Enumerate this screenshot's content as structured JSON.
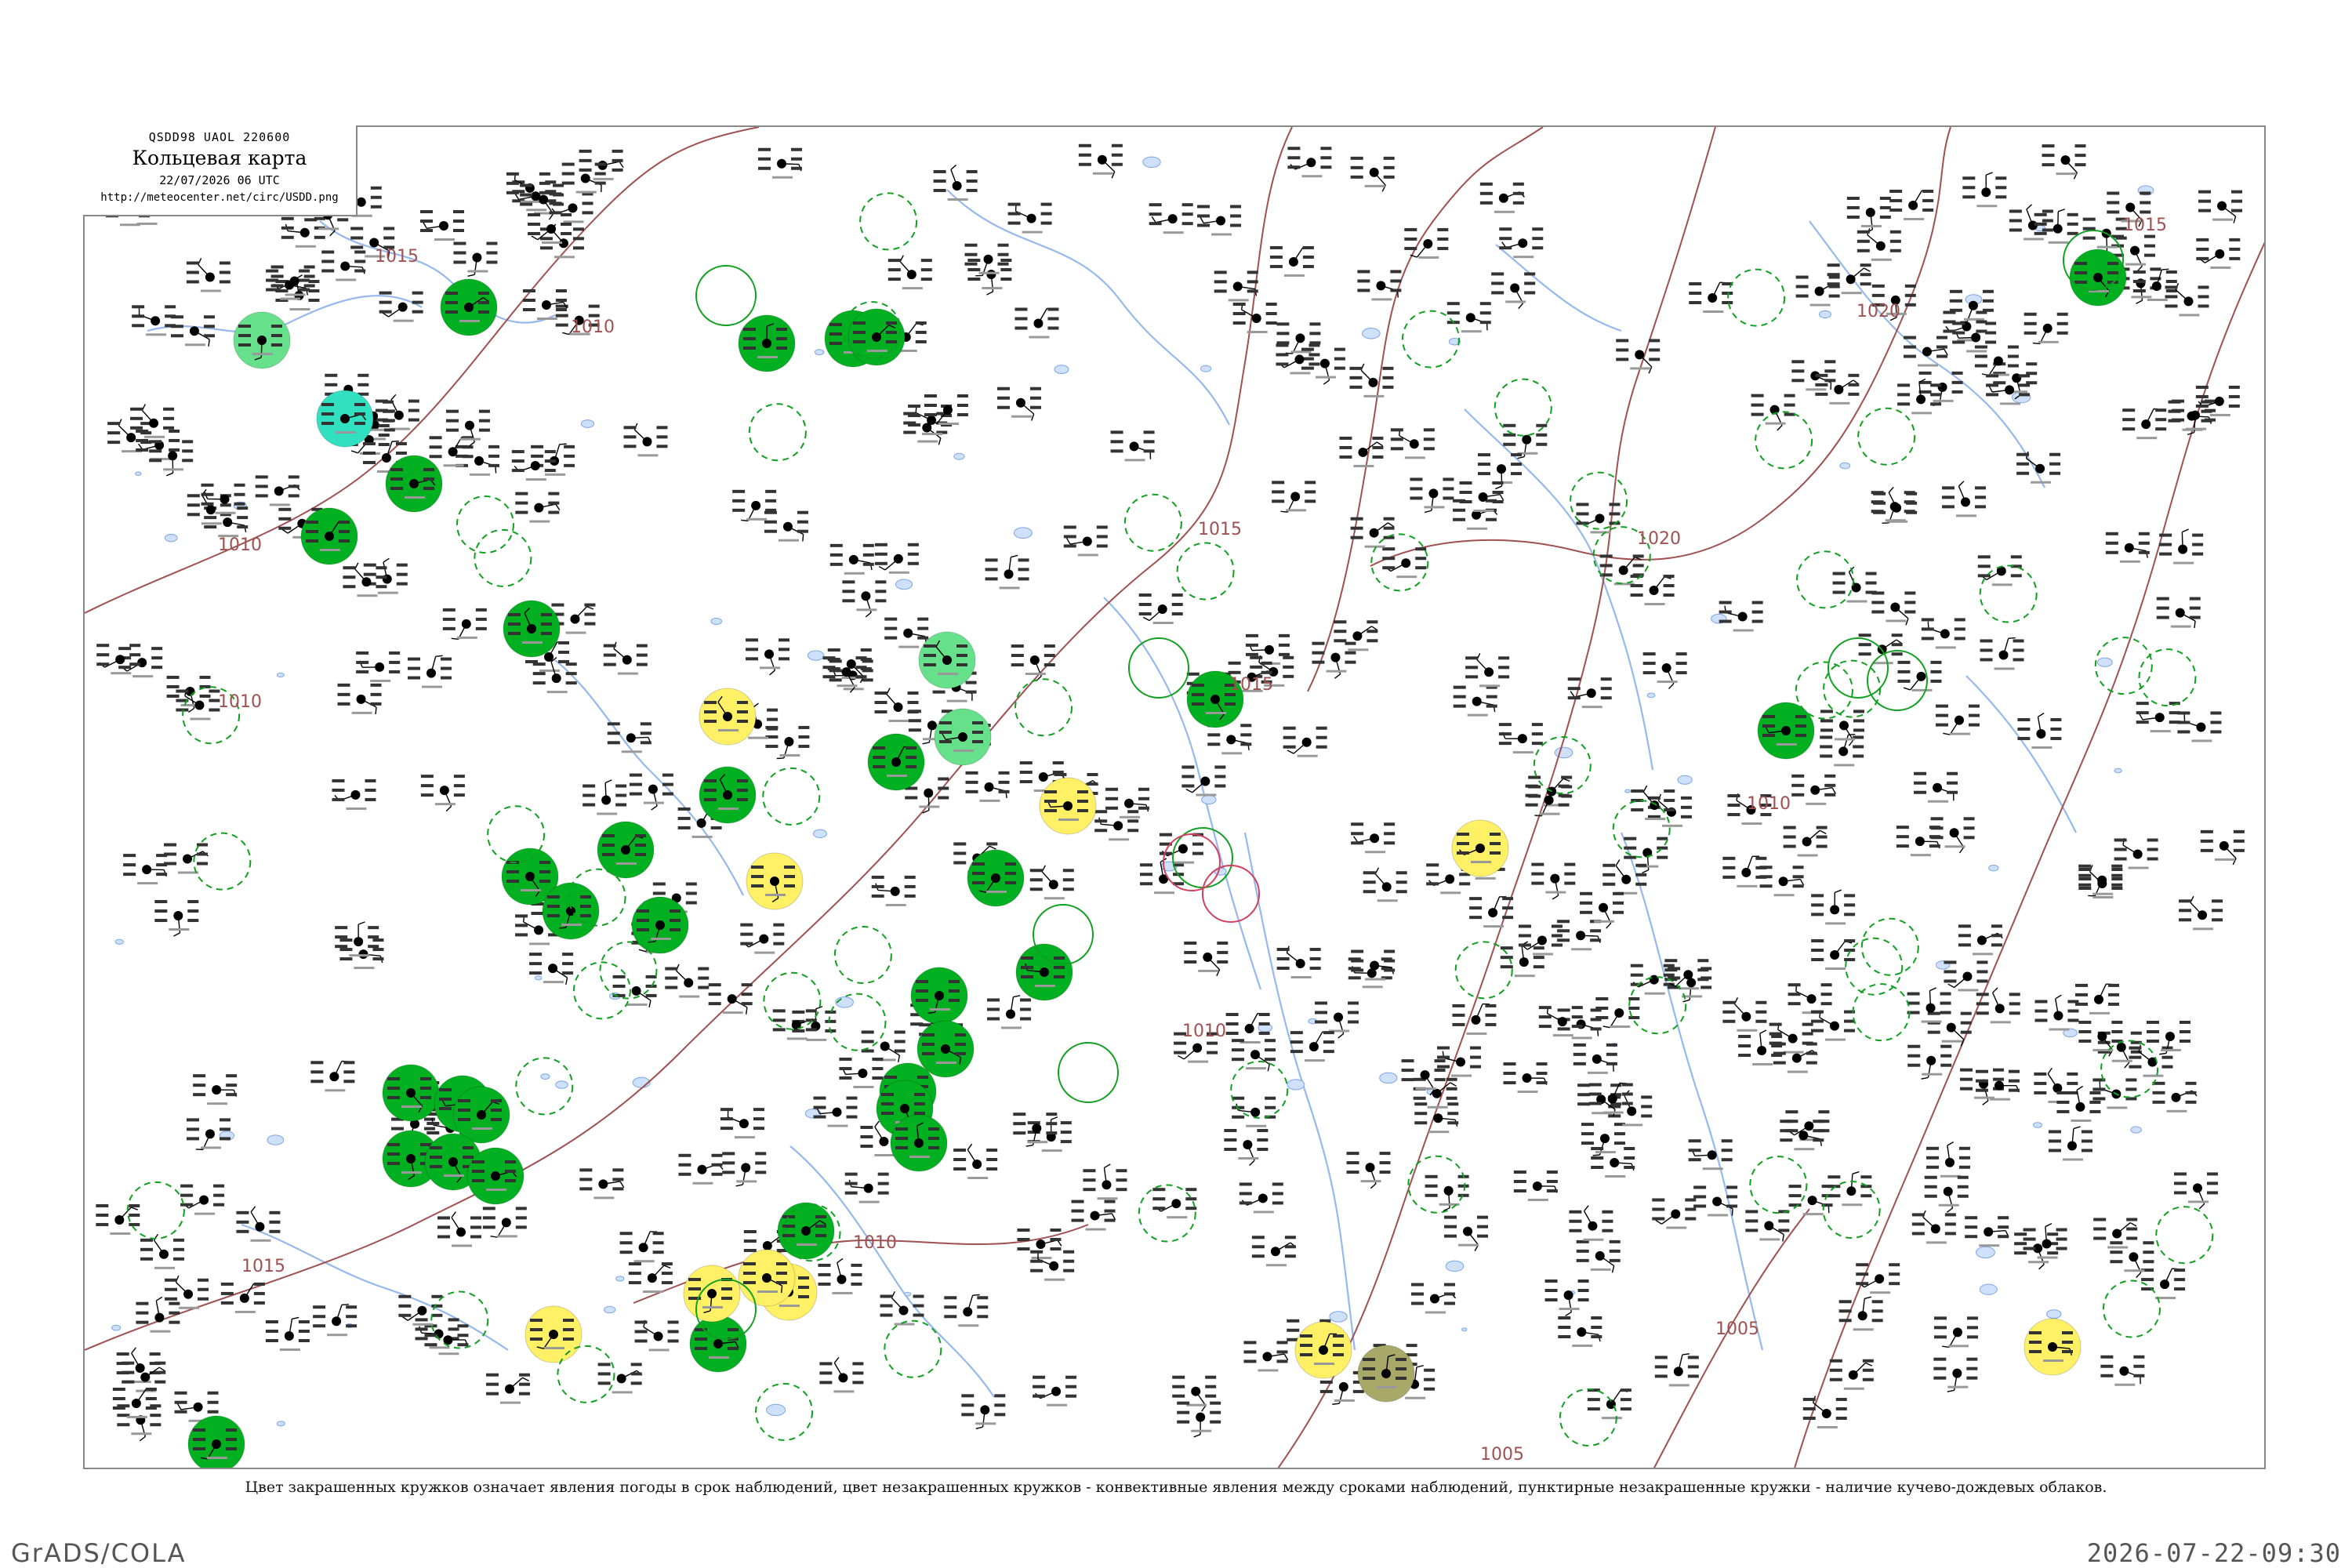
{
  "header": {
    "code_line": "QSDD98  UAOL  220600",
    "title": "Кольцевая карта",
    "datetime": "22/07/2026 06 UTC",
    "url": "http://meteocenter.net/circ/USDD.png"
  },
  "caption": "Цвет закрашенных кружков означает явления погоды в срок наблюдений, цвет незакрашенных кружков - конвективные явления между сроками наблюдений, пунктирные незакрашенные кружки - наличие кучево-дождевых облаков.",
  "footer": {
    "software": "GrADS/COLA",
    "timestamp": "2026-07-22-09:30"
  },
  "colors": {
    "rain": "#00b020",
    "rain_light": "#66e08a",
    "drizzle_cyan": "#30e0c0",
    "haze_yellow": "#fff066",
    "fog_olive": "#a8a868",
    "isobar": "#a05050",
    "river": "#7aa6e8",
    "convective_ring": "#10a020",
    "thunder_ring": "#d04060"
  },
  "isobar_labels": [
    "1015",
    "1010",
    "1010",
    "1015",
    "1020",
    "1020",
    "1015",
    "1010",
    "1010",
    "1005",
    "1010",
    "1015",
    "1010",
    "1015",
    "1005"
  ],
  "stations": [
    {
      "type": "filled",
      "color": "rain"
    },
    {
      "type": "filled",
      "color": "rain"
    },
    {
      "type": "filled",
      "color": "rain"
    },
    {
      "type": "filled",
      "color": "rain_light"
    },
    {
      "type": "filled",
      "color": "drizzle_cyan"
    },
    {
      "type": "filled",
      "color": "haze_yellow"
    },
    {
      "type": "filled",
      "color": "fog_olive"
    },
    {
      "type": "ring",
      "color": "convective_ring"
    },
    {
      "type": "dashed",
      "color": "convective_ring"
    },
    {
      "type": "ring",
      "color": "thunder_ring"
    }
  ]
}
